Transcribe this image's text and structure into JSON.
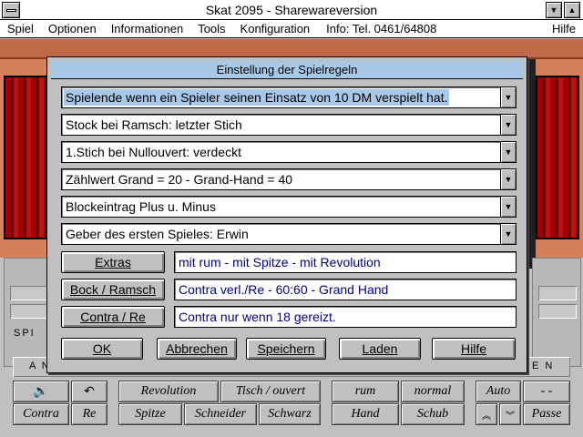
{
  "window": {
    "title": "Skat 2095 - Sharewareversion",
    "minimize_icon": "▼",
    "maximize_icon": "▲"
  },
  "menu": {
    "items": [
      "Spiel",
      "Optionen",
      "Informationen",
      "Tools",
      "Konfiguration"
    ],
    "info": "Info: Tel. 0461/64808",
    "help": "Hilfe"
  },
  "scene": {
    "left_side_text": "SPI",
    "strip_left": "A N",
    "strip_right": "E N"
  },
  "bottom_buttons": {
    "row1": [
      "Revolution",
      "Tisch / ouvert",
      "rum",
      "normal",
      "Auto",
      "- -"
    ],
    "row2": [
      "Contra",
      "Re",
      "Spitze",
      "Schneider",
      "Schwarz",
      "Hand",
      "Schub",
      "Passe"
    ],
    "undo_icon": "↶"
  },
  "dialog": {
    "title": "Einstellung der Spielregeln",
    "combos": [
      "Spielende wenn ein Spieler seinen Einsatz von 10 DM verspielt hat.",
      "Stock bei Ramsch: letzter Stich",
      "1.Stich bei Nullouvert: verdeckt",
      "Zählwert Grand = 20 - Grand-Hand = 40",
      "Blockeintrag Plus u. Minus",
      "Geber des ersten Spieles: Erwin"
    ],
    "rows": [
      {
        "button": "Extras",
        "value": "mit rum - mit Spitze - mit Revolution"
      },
      {
        "button": "Bock / Ramsch",
        "value": "Contra verl./Re - 60:60 - Grand Hand"
      },
      {
        "button": "Contra / Re",
        "value": "Contra nur wenn 18 gereizt."
      }
    ],
    "actions": {
      "ok": "OK",
      "cancel": "Abbrechen",
      "save": "Speichern",
      "load": "Laden",
      "help": "Hilfe"
    },
    "arrow_icon": "▼"
  },
  "colors": {
    "selection": "#a8c8e8",
    "field_text": "#00008b",
    "wall": "#d4805a",
    "curtain": "#a00000"
  }
}
